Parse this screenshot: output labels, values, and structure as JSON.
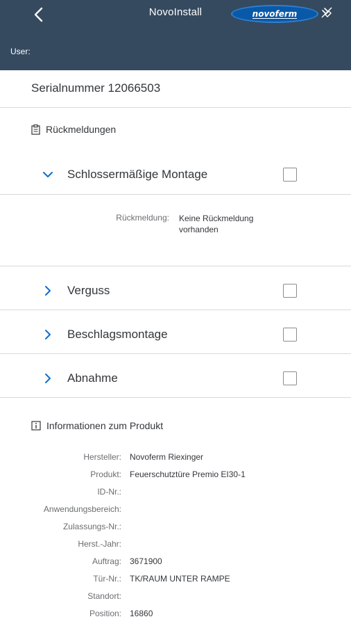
{
  "header": {
    "title": "NovoInstall",
    "logo_text": "novoferm",
    "user_label": "User:",
    "bg_color": "#354a5f"
  },
  "serial": {
    "text": "Serialnummer 12066503"
  },
  "feedback_section": {
    "title": "Rückmeldungen",
    "icon": "clipboard-icon",
    "items": [
      {
        "label": "Schlossermäßige Montage",
        "expanded": true,
        "checked": false
      },
      {
        "label": "Verguss",
        "expanded": false,
        "checked": false
      },
      {
        "label": "Beschlagsmontage",
        "expanded": false,
        "checked": false
      },
      {
        "label": "Abnahme",
        "expanded": false,
        "checked": false
      }
    ],
    "detail": {
      "key": "Rückmeldung:",
      "value": "Keine Rückmeldung vorhanden"
    }
  },
  "product_section": {
    "title": "Informationen zum Produkt",
    "icon": "info-icon",
    "fields": [
      {
        "key": "Hersteller:",
        "value": "Novoferm Riexinger"
      },
      {
        "key": "Produkt:",
        "value": "Feuerschutztüre Premio EI30-1"
      },
      {
        "key": "ID-Nr.:",
        "value": ""
      },
      {
        "key": "Anwendungsbereich:",
        "value": ""
      },
      {
        "key": "Zulassungs-Nr.:",
        "value": ""
      },
      {
        "key": "Herst.-Jahr:",
        "value": ""
      },
      {
        "key": "Auftrag:",
        "value": "3671900"
      },
      {
        "key": "Tür-Nr.:",
        "value": "TK/RAUM UNTER RAMPE"
      },
      {
        "key": "Standort:",
        "value": ""
      },
      {
        "key": "Position:",
        "value": "16860"
      }
    ]
  }
}
